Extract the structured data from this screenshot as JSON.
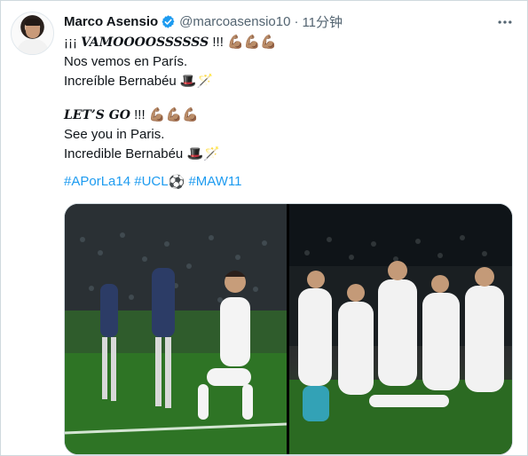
{
  "user": {
    "name": "Marco Asensio",
    "handle": "@marcoasensio10",
    "separator": "·",
    "time": "11分钟"
  },
  "text": {
    "l1_prefix": "¡¡¡ ",
    "l1_strong": "VAMOOOOSSSSSS",
    "l1_suffix": " !!! ",
    "l2": "Nos vemos en París.",
    "l3": "Increíble Bernabéu ",
    "l4_strong": "LET’S GO",
    "l4_suffix": " !!! ",
    "l5": "See you in Paris.",
    "l6": "Incredible Bernabéu "
  },
  "emoji": {
    "muscles": "💪🏽💪🏽💪🏽",
    "hat_wand": "🎩🪄",
    "ball": "⚽"
  },
  "hashtags": [
    "#APorLa14",
    "#UCL",
    "#MAW11"
  ],
  "colors": {
    "link": "#1d9bf0",
    "verified": "#1d9bf0",
    "muted": "#536471",
    "pitch": "#2d6b21"
  },
  "icons": [
    "verified-badge-icon",
    "more-icon"
  ]
}
